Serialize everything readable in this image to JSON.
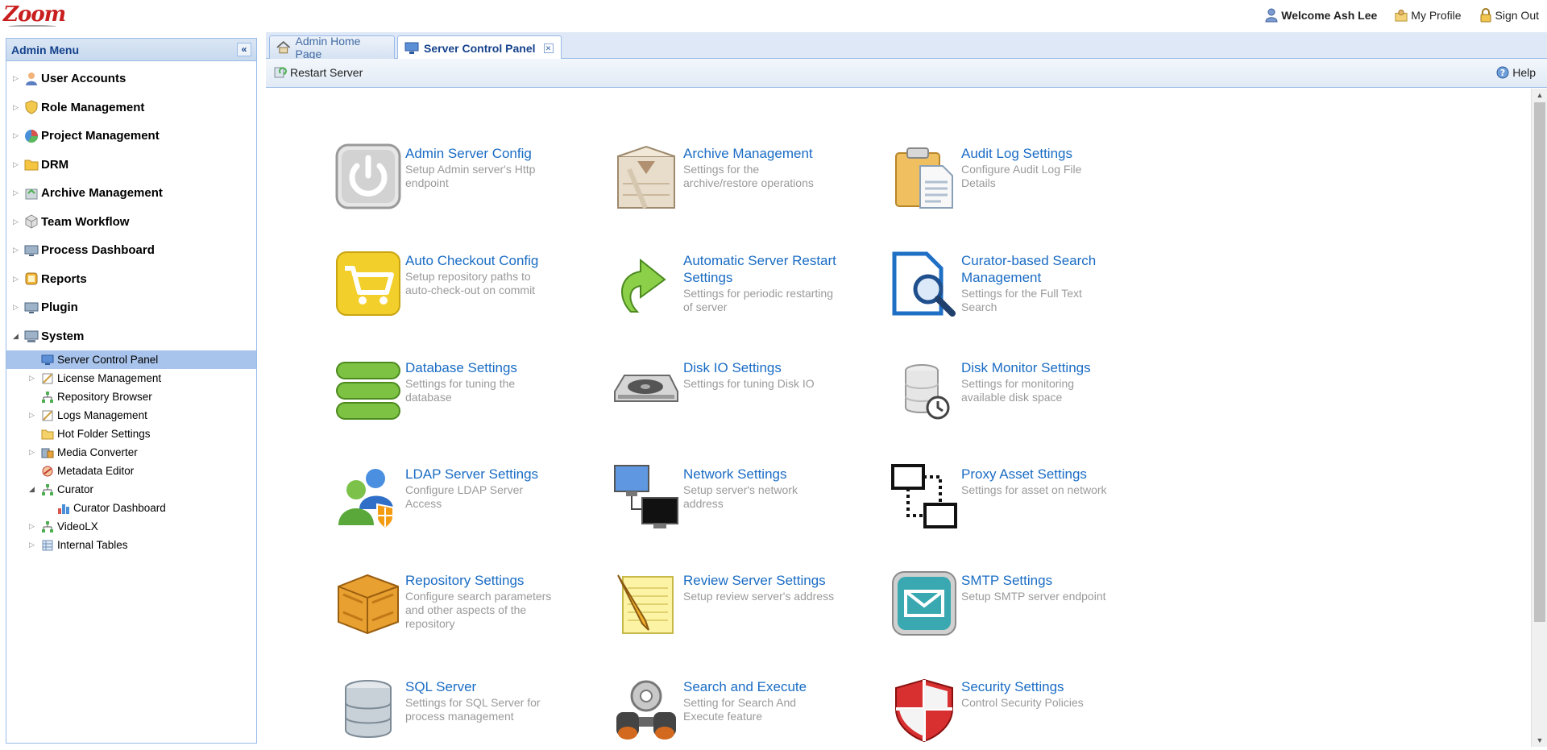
{
  "app": {
    "logo_text": "Zoom",
    "welcome": "Welcome Ash Lee",
    "my_profile": "My Profile",
    "sign_out": "Sign Out"
  },
  "sidebar": {
    "title": "Admin Menu",
    "collapse_icon": "double-chevron-left-icon",
    "items": [
      {
        "label": "User Accounts",
        "icon": "user-icon",
        "color": "#5b7fc2"
      },
      {
        "label": "Role Management",
        "icon": "shield-icon",
        "color": "#e8b923"
      },
      {
        "label": "Project Management",
        "icon": "pie-chart-icon",
        "color": "#d9534f"
      },
      {
        "label": "DRM",
        "icon": "folder-icon",
        "color": "#f5c542"
      },
      {
        "label": "Archive Management",
        "icon": "archive-icon",
        "color": "#6aa84f"
      },
      {
        "label": "Team Workflow",
        "icon": "cubes-icon",
        "color": "#9e9e9e"
      },
      {
        "label": "Process Dashboard",
        "icon": "monitor-icon",
        "color": "#7a8fa8"
      },
      {
        "label": "Reports",
        "icon": "reports-icon",
        "color": "#e6a817"
      },
      {
        "label": "Plugin",
        "icon": "monitor-icon",
        "color": "#7a8fa8"
      },
      {
        "label": "System",
        "icon": "computer-icon",
        "color": "#7a8fa8"
      }
    ],
    "system_children": [
      {
        "label": "Server Control Panel",
        "icon": "monitor-icon",
        "level": 1,
        "expandable": false,
        "selected": true
      },
      {
        "label": "License Management",
        "icon": "license-icon",
        "level": 1,
        "expandable": true
      },
      {
        "label": "Repository Browser",
        "icon": "tree-icon",
        "level": 1,
        "expandable": false
      },
      {
        "label": "Logs Management",
        "icon": "logs-icon",
        "level": 1,
        "expandable": true
      },
      {
        "label": "Hot Folder Settings",
        "icon": "folder-icon",
        "level": 1,
        "expandable": false
      },
      {
        "label": "Media Converter",
        "icon": "converter-icon",
        "level": 1,
        "expandable": true
      },
      {
        "label": "Metadata Editor",
        "icon": "metadata-icon",
        "level": 1,
        "expandable": false
      },
      {
        "label": "Curator",
        "icon": "tree-icon",
        "level": 1,
        "expandable": true,
        "expanded": true
      },
      {
        "label": "Curator Dashboard",
        "icon": "bar-chart-icon",
        "level": 2,
        "expandable": false
      },
      {
        "label": "VideoLX",
        "icon": "tree-icon",
        "level": 1,
        "expandable": true
      },
      {
        "label": "Internal Tables",
        "icon": "table-icon",
        "level": 1,
        "expandable": true
      }
    ]
  },
  "tabs": [
    {
      "label": "Admin Home Page",
      "icon": "home-icon",
      "active": false
    },
    {
      "label": "Server Control Panel",
      "icon": "monitor-icon",
      "active": true
    }
  ],
  "toolbar": {
    "restart_label": "Restart Server",
    "help_label": "Help"
  },
  "cards": [
    {
      "title": "Admin Server Config",
      "desc": "Setup Admin server's Http endpoint",
      "icon": "power-icon"
    },
    {
      "title": "Archive Management",
      "desc": "Settings for the archive/restore operations",
      "icon": "archive-box-icon"
    },
    {
      "title": "Audit Log Settings",
      "desc": "Configure Audit Log File Details",
      "icon": "clipboard-icon"
    },
    {
      "title": "Auto Checkout Config",
      "desc": "Setup repository paths to auto-check-out on commit",
      "icon": "cart-icon"
    },
    {
      "title": "Automatic Server Restart Settings",
      "desc": "Settings for periodic restarting of server",
      "icon": "curved-arrow-icon"
    },
    {
      "title": "Curator-based Search Management",
      "desc": "Settings for the Full Text Search",
      "icon": "search-document-icon"
    },
    {
      "title": "Database Settings",
      "desc": "Settings for tuning the database",
      "icon": "database-stack-icon"
    },
    {
      "title": "Disk IO Settings",
      "desc": "Settings for tuning Disk IO",
      "icon": "hard-disk-icon"
    },
    {
      "title": "Disk Monitor Settings",
      "desc": "Settings for monitoring available disk space",
      "icon": "disk-clock-icon"
    },
    {
      "title": "LDAP Server Settings",
      "desc": "Configure LDAP Server Access",
      "icon": "users-shield-icon"
    },
    {
      "title": "Network Settings",
      "desc": "Setup server's network address",
      "icon": "network-computers-icon"
    },
    {
      "title": "Proxy Asset Settings",
      "desc": "Settings for asset on network",
      "icon": "proxy-icon"
    },
    {
      "title": "Repository Settings",
      "desc": "Configure search parameters and other aspects of the repository",
      "icon": "crate-icon"
    },
    {
      "title": "Review Server Settings",
      "desc": "Setup review server's address",
      "icon": "notepad-pencil-icon"
    },
    {
      "title": "SMTP Settings",
      "desc": "Setup SMTP server endpoint",
      "icon": "envelope-icon"
    },
    {
      "title": "SQL Server",
      "desc": "Settings for SQL Server for process management",
      "icon": "database-icon"
    },
    {
      "title": "Search and Execute",
      "desc": "Setting for Search And Execute feature",
      "icon": "binoculars-gear-icon"
    },
    {
      "title": "Security Settings",
      "desc": "Control Security Policies",
      "icon": "security-shield-icon"
    }
  ]
}
